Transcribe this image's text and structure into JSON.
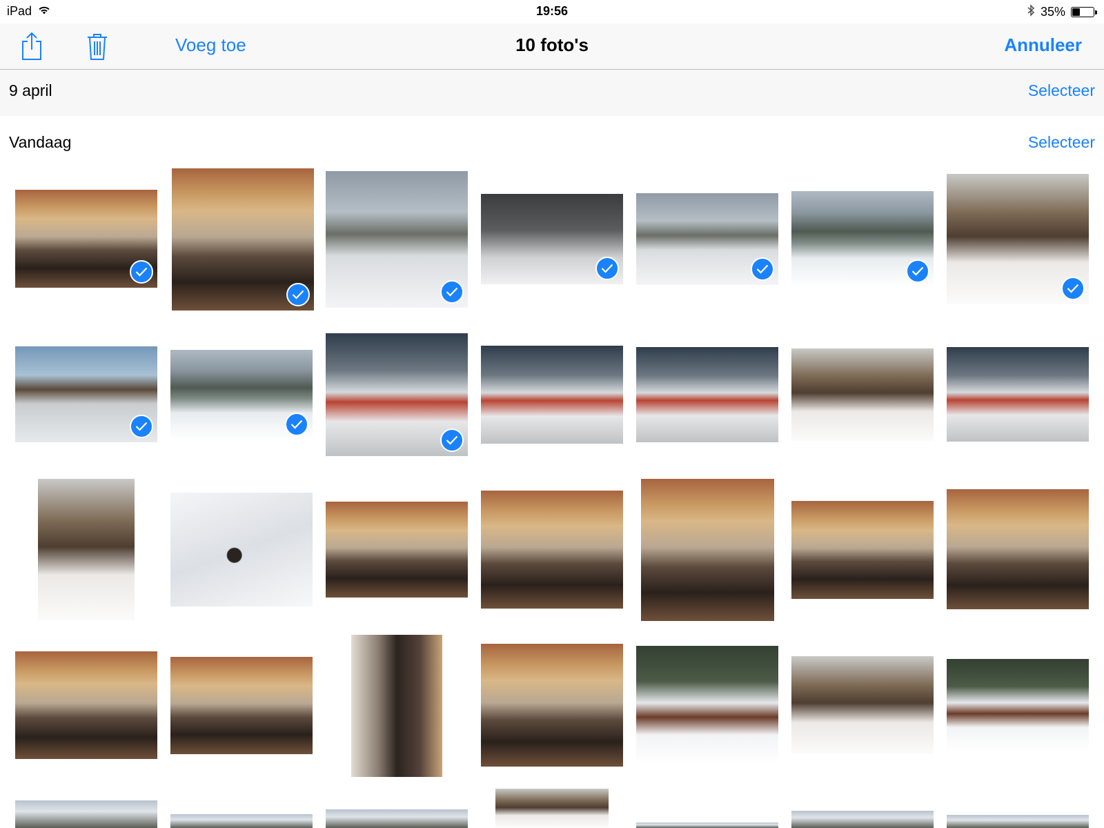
{
  "status_bar": {
    "device": "iPad",
    "time": "19:56",
    "battery_text": "35%",
    "battery_level": 0.35,
    "wifi_icon": "wifi-icon",
    "bluetooth_icon": "bluetooth-icon"
  },
  "nav": {
    "share_icon": "share-icon",
    "trash_icon": "trash-icon",
    "add_label": "Voeg toe",
    "title": "10 foto's",
    "cancel_label": "Annuleer"
  },
  "sections": [
    {
      "label": "9 april",
      "select_label": "Selecteer"
    },
    {
      "label": "Vandaag",
      "select_label": "Selecteer"
    }
  ],
  "colors": {
    "accent": "#1a82fb",
    "selected_check": "#1a82fb"
  },
  "photos": [
    {
      "scene": "caravan interior",
      "selected": true
    },
    {
      "scene": "caravan interior",
      "selected": true
    },
    {
      "scene": "snowy campsite with car",
      "selected": true
    },
    {
      "scene": "caravans in snowfall",
      "selected": true
    },
    {
      "scene": "snow covered car",
      "selected": true
    },
    {
      "scene": "mountain valley",
      "selected": true
    },
    {
      "scene": "snow valley",
      "selected": true
    },
    {
      "scene": "ice skating",
      "selected": true
    },
    {
      "scene": "snowy forest river",
      "selected": true
    },
    {
      "scene": "campsite caravans",
      "selected": true
    },
    {
      "scene": "campsite caravans",
      "selected": false
    },
    {
      "scene": "campsite caravans",
      "selected": false
    },
    {
      "scene": "campsite valley",
      "selected": false
    },
    {
      "scene": "campsite mountains",
      "selected": false
    },
    {
      "scene": "mountain with caravan",
      "selected": false
    },
    {
      "scene": "cat in snow",
      "selected": false
    },
    {
      "scene": "caravan interior",
      "selected": false
    },
    {
      "scene": "caravan interior",
      "selected": false
    },
    {
      "scene": "caravan interior",
      "selected": false
    },
    {
      "scene": "caravan interior",
      "selected": false
    },
    {
      "scene": "caravan interior",
      "selected": false
    },
    {
      "scene": "caravan interior",
      "selected": false
    },
    {
      "scene": "caravan interior",
      "selected": false
    },
    {
      "scene": "caravan doorway",
      "selected": false
    },
    {
      "scene": "caravan interior",
      "selected": false
    },
    {
      "scene": "snowy cabin",
      "selected": false
    },
    {
      "scene": "snowy valley with person",
      "selected": false
    },
    {
      "scene": "snowy cabin with dog",
      "selected": false
    },
    {
      "scene": "snow scene",
      "selected": false
    },
    {
      "scene": "snow scene",
      "selected": false
    },
    {
      "scene": "snow scene",
      "selected": false
    },
    {
      "scene": "mountain scene",
      "selected": false
    },
    {
      "scene": "snow scene",
      "selected": false
    },
    {
      "scene": "snow scene",
      "selected": false
    },
    {
      "scene": "snow scene",
      "selected": false
    }
  ]
}
